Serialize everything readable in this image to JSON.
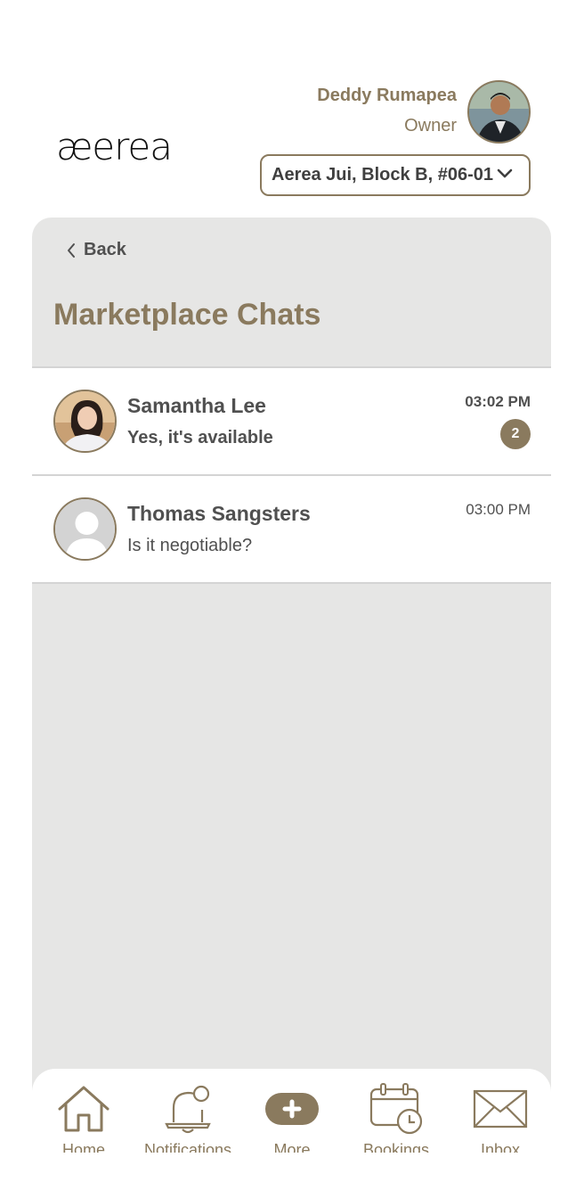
{
  "header": {
    "logo_text": "æerea",
    "user_name": "Deddy Rumapea",
    "user_role": "Owner",
    "unit_selected": "Aerea Jui, Block B, #06-01"
  },
  "page": {
    "back_label": "Back",
    "title": "Marketplace Chats"
  },
  "chats": [
    {
      "name": "Samantha Lee",
      "message": "Yes, it's available",
      "time": "03:02 PM",
      "unread": "2"
    },
    {
      "name": "Thomas Sangsters",
      "message": "Is it negotiable?",
      "time": "03:00 PM"
    }
  ],
  "nav": {
    "home": "Home",
    "notifications": "Notifications",
    "more": "More",
    "bookings": "Bookings",
    "inbox": "Inbox"
  },
  "colors": {
    "accent": "#8a7a5e",
    "panel": "#e6e6e5",
    "text": "#505050"
  }
}
